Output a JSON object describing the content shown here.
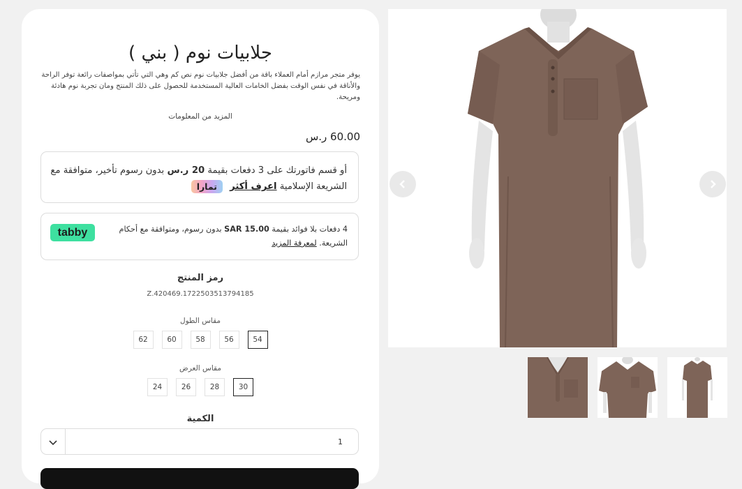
{
  "product": {
    "title": "جلابيات نوم ( بني )",
    "description": "يوفر متجر مرازم أمام العملاء باقة من أفضل جلابيات نوم نص كم وهي التي تأتي بمواصفات رائعة توفر الراحة والأناقة في نفس الوقت بفضل الخامات العالية المستخدمة للحصول على ذلك المنتج ومان تجربة نوم هادئة ومريحة.",
    "more_info": "المزيد من المعلومات",
    "price": "60.00 ر.س"
  },
  "tamara": {
    "text_before": "أو قسم فاتورتك على 3 دفعات بقيمة",
    "amount": "20 ر.س",
    "text_after": "بدون رسوم تأخير، متوافقة مع الشريعة الإسلامية",
    "link": "اعرف أكثر",
    "logo": "تمارا"
  },
  "tabby": {
    "text_before": "4 دفعات بلا فوائد بقيمة",
    "amount": "SAR 15.00",
    "text_after": "بدون رسوم، ومتوافقة مع أحكام الشريعة.",
    "link": "لمعرفة المزيد",
    "logo": "tabby"
  },
  "sku": {
    "label": "رمز المنتج",
    "value": "Z.420469.1722503513794185"
  },
  "length": {
    "label": "مقاس الطول",
    "options": [
      "54",
      "56",
      "58",
      "60",
      "62"
    ],
    "selected": "54"
  },
  "width": {
    "label": "مقاس العرض",
    "options": [
      "30",
      "28",
      "26",
      "24"
    ],
    "selected": "30"
  },
  "quantity": {
    "label": "الكمية",
    "value": "1"
  },
  "colors": {
    "garment": "#7e6458",
    "garment_dark": "#6b5247",
    "tabby_green": "#3ee0a0"
  },
  "icons": {
    "prev": "chevron-left-icon",
    "next": "chevron-right-icon",
    "dropdown": "chevron-down-icon"
  }
}
